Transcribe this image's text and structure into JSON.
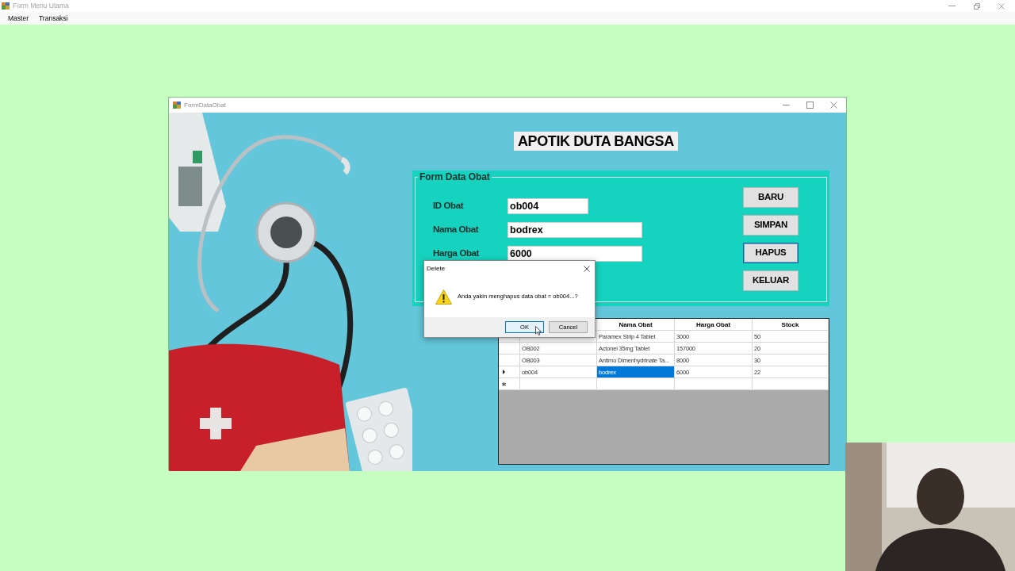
{
  "window": {
    "title": "Form Menu Utama"
  },
  "menu": [
    "Master",
    "Transaksi"
  ],
  "child_window": {
    "title": "FormDataObat",
    "header": "APOTIK DUTA BANGSA",
    "group": {
      "title": "Form Data Obat",
      "fields": [
        {
          "label": "ID Obat",
          "value": "ob004"
        },
        {
          "label": "Nama Obat",
          "value": "bodrex"
        },
        {
          "label": "Harga Obat",
          "value": "6000"
        }
      ],
      "buttons": [
        {
          "label": "BARU",
          "focused": false
        },
        {
          "label": "SIMPAN",
          "focused": false
        },
        {
          "label": "HAPUS",
          "focused": true
        },
        {
          "label": "KELUAR",
          "focused": false
        }
      ]
    },
    "table": {
      "columns": [
        "Nama Obat",
        "Harga Obat",
        "Stock"
      ],
      "rows": [
        {
          "cells": [
            {
              "text": "Paramex Strip 4 Tablet",
              "selected": false
            },
            {
              "text": "3000",
              "selected": false
            },
            {
              "text": "50",
              "selected": false
            }
          ]
        },
        {
          "current": false,
          "id": "OB002",
          "cells": [
            {
              "text": "Actonel 35mg Tablet",
              "selected": false
            },
            {
              "text": "157000",
              "selected": false
            },
            {
              "text": "20",
              "selected": false
            }
          ]
        },
        {
          "current": false,
          "id": "OB003",
          "cells": [
            {
              "text": "Antimo Dimenhydrinate Ta...",
              "selected": false
            },
            {
              "text": "8000",
              "selected": false
            },
            {
              "text": "30",
              "selected": false
            }
          ]
        },
        {
          "current": true,
          "id": "ob004",
          "cells": [
            {
              "text": "bodrex",
              "selected": true
            },
            {
              "text": "6000",
              "selected": false
            },
            {
              "text": "22",
              "selected": false
            }
          ]
        }
      ],
      "new_row": true
    }
  },
  "dialog": {
    "title": "Delete",
    "message": "Anda yakin menghapus data obat = ob004...?",
    "buttons": [
      {
        "label": "OK",
        "default": true
      },
      {
        "label": "Cancel",
        "default": false
      }
    ]
  }
}
